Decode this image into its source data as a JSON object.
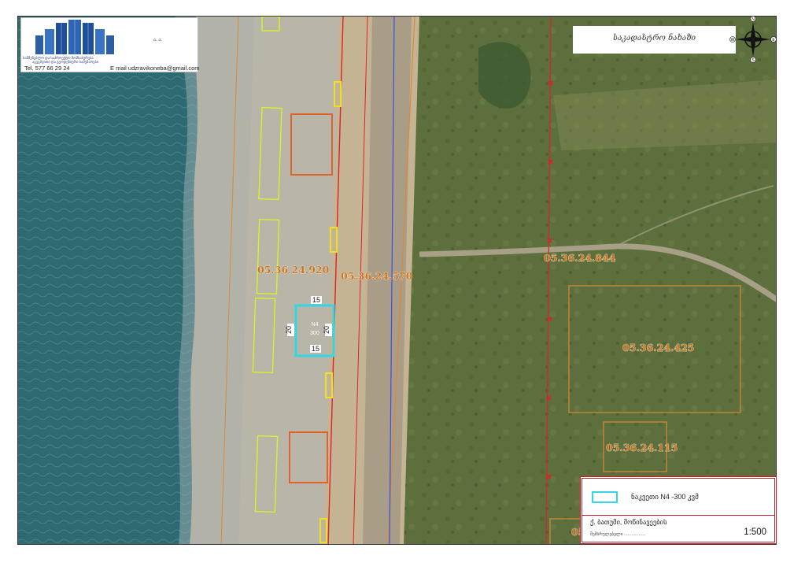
{
  "map": {
    "parcels": {
      "p920": "05.36.24.920",
      "p570": "05.36.24.570",
      "p844": "05.36.24.844",
      "p425": "05.36.24.425",
      "p115": "05.36.24.115",
      "p05": "05"
    },
    "plot": {
      "name": "N4",
      "area": "300",
      "top_dim": "15",
      "bottom_dim": "15",
      "left_dim": "20",
      "right_dim": "20"
    },
    "colors": {
      "sea": "#2d6a72",
      "beach": "#b3b2a9",
      "road": "#c5b494",
      "vegetation": "#5d6f3c",
      "red_line": "#e0202a",
      "blue_line": "#3b4fe0",
      "orange_line": "#d88a3a",
      "yellow_green_plot": "#d7f22c",
      "orange_plot": "#e0642a",
      "selected_plot": "#33d6e4"
    }
  },
  "logo": {
    "small_text": "ა. ა.",
    "company_line1": "სამშენებლო და საპროექტო მომსახურება",
    "company_line2": "აგეგმვითი და გეოდეზიური სამუშაოები",
    "tel": "Tel.   577 66 29 24",
    "email": "E mail   udzravikoneba@gmail.com"
  },
  "title": {
    "text": "საკადასტრო ნახაზი"
  },
  "compass": {
    "n": "N",
    "s": "S",
    "w": "W",
    "e": "E"
  },
  "legend": {
    "swatch_label": "ნაკვეთი  N4  -300  კვმ",
    "location": "ქ. ბათუმი,  მოწინავეების",
    "prepared_by": "შემსრულებელი ..................",
    "scale": "1:500"
  }
}
